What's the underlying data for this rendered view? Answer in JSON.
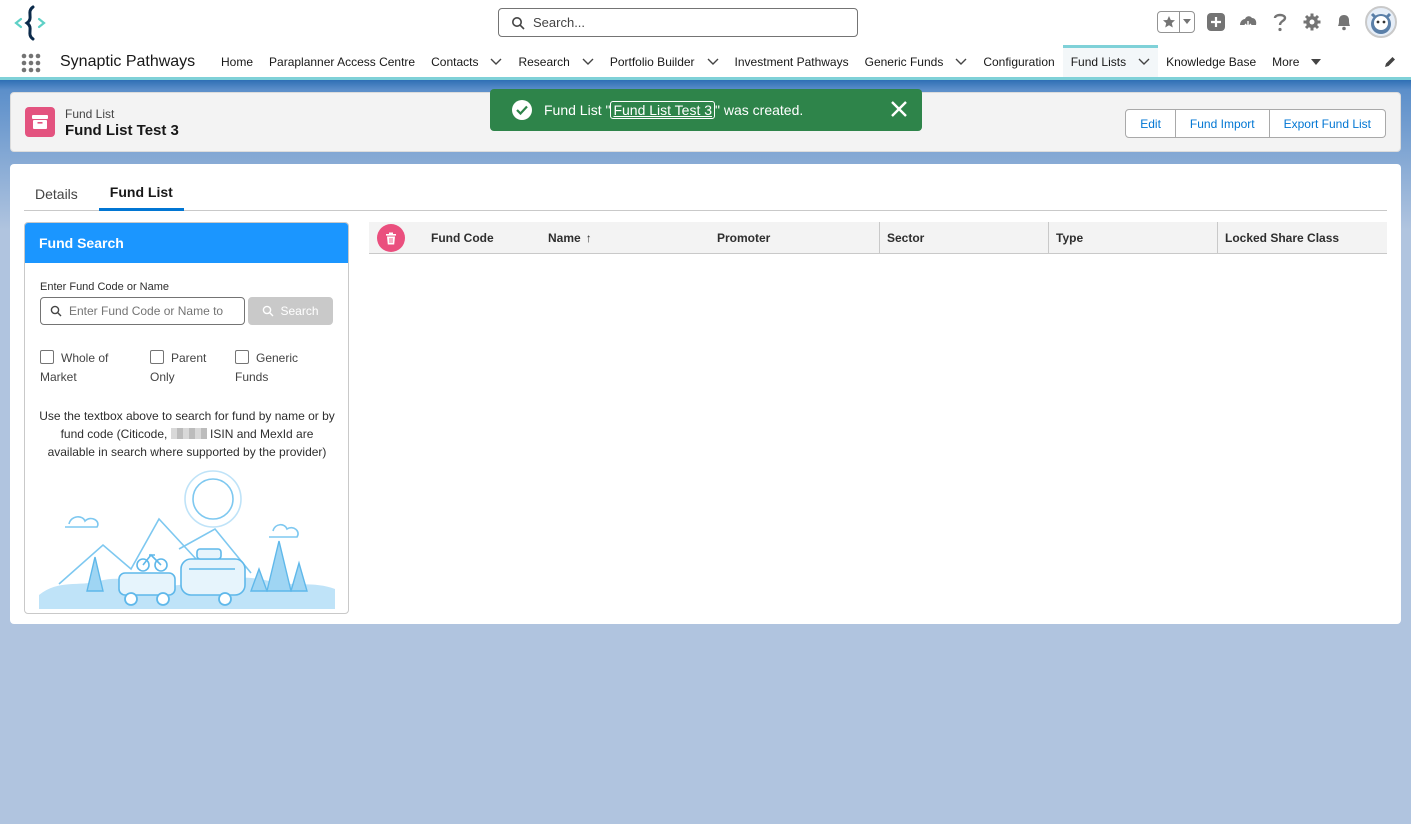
{
  "header": {
    "search_placeholder": "Search...",
    "icons": [
      "star-icon",
      "add-icon",
      "trailhead-icon",
      "help-icon",
      "setup-gear-icon",
      "notification-bell-icon",
      "avatar"
    ]
  },
  "nav": {
    "app_name": "Synaptic Pathways",
    "items": [
      {
        "label": "Home",
        "has_menu": false
      },
      {
        "label": "Paraplanner Access Centre",
        "has_menu": false
      },
      {
        "label": "Contacts",
        "has_menu": true
      },
      {
        "label": "Research",
        "has_menu": true
      },
      {
        "label": "Portfolio Builder",
        "has_menu": true
      },
      {
        "label": "Investment Pathways",
        "has_menu": false
      },
      {
        "label": "Generic Funds",
        "has_menu": true
      },
      {
        "label": "Configuration",
        "has_menu": false
      },
      {
        "label": "Fund Lists",
        "has_menu": true,
        "active": true
      },
      {
        "label": "Knowledge Base",
        "has_menu": false
      },
      {
        "label": "More",
        "has_menu": true
      }
    ]
  },
  "record": {
    "type": "Fund List",
    "title": "Fund List Test 3",
    "buttons": [
      "Edit",
      "Fund Import",
      "Export Fund List"
    ]
  },
  "toast": {
    "prefix": "Fund List \"",
    "link": "Fund List Test 3",
    "suffix": "\" was created."
  },
  "tabs": [
    "Details",
    "Fund List"
  ],
  "fund_search": {
    "title": "Fund Search",
    "field_label": "Enter Fund Code or Name",
    "input_placeholder": "Enter Fund Code or Name to",
    "search_button": "Search",
    "checkboxes": [
      {
        "line1": "Whole of",
        "line2": "Market",
        "checked": false
      },
      {
        "line1": "Parent",
        "line2": "Only",
        "checked": false
      },
      {
        "line1": "Generic",
        "line2": "Funds",
        "checked": false
      }
    ],
    "help_text_1": "Use the textbox above to search for fund by name or by fund code (Citicode,",
    "help_text_2": "ISIN and MexId are available in search where supported by the provider)"
  },
  "table": {
    "columns": [
      "Fund Code",
      "Name",
      "Promoter",
      "Sector",
      "Type",
      "Locked Share Class"
    ],
    "sort_indicator": "↑"
  },
  "colors": {
    "accent": "#0176d3",
    "toast_success": "#2e844a",
    "record_icon": "#e3537f",
    "panel_header": "#1b96ff"
  }
}
